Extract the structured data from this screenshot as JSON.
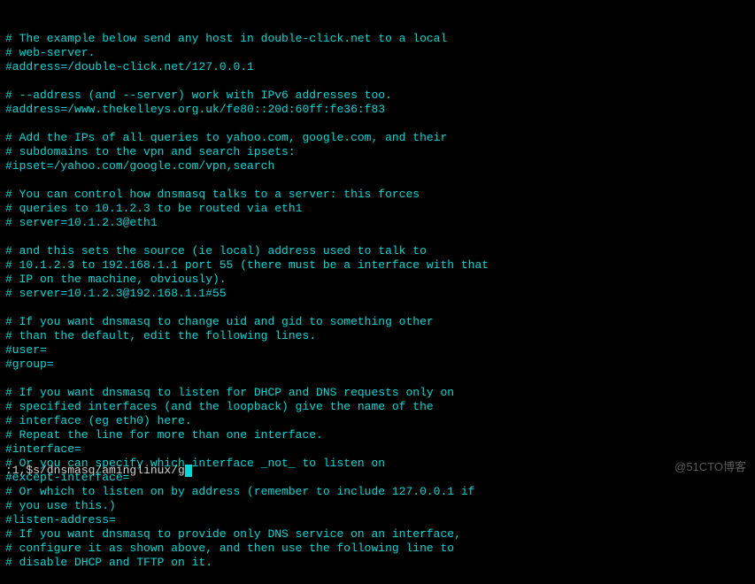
{
  "lines": [
    "# The example below send any host in double-click.net to a local",
    "# web-server.",
    "#address=/double-click.net/127.0.0.1",
    "",
    "# --address (and --server) work with IPv6 addresses too.",
    "#address=/www.thekelleys.org.uk/fe80::20d:60ff:fe36:f83",
    "",
    "# Add the IPs of all queries to yahoo.com, google.com, and their",
    "# subdomains to the vpn and search ipsets:",
    "#ipset=/yahoo.com/google.com/vpn,search",
    "",
    "# You can control how dnsmasq talks to a server: this forces",
    "# queries to 10.1.2.3 to be routed via eth1",
    "# server=10.1.2.3@eth1",
    "",
    "# and this sets the source (ie local) address used to talk to",
    "# 10.1.2.3 to 192.168.1.1 port 55 (there must be a interface with that",
    "# IP on the machine, obviously).",
    "# server=10.1.2.3@192.168.1.1#55",
    "",
    "# If you want dnsmasq to change uid and gid to something other",
    "# than the default, edit the following lines.",
    "#user=",
    "#group=",
    "",
    "# If you want dnsmasq to listen for DHCP and DNS requests only on",
    "# specified interfaces (and the loopback) give the name of the",
    "# interface (eg eth0) here.",
    "# Repeat the line for more than one interface.",
    "#interface=",
    "# Or you can specify which interface _not_ to listen on",
    "#except-interface=",
    "# Or which to listen on by address (remember to include 127.0.0.1 if",
    "# you use this.)",
    "#listen-address=",
    "# If you want dnsmasq to provide only DNS service on an interface,",
    "# configure it as shown above, and then use the following line to",
    "# disable DHCP and TFTP on it."
  ],
  "status": ":1,$s/dnsmasq/aminglinux/g",
  "watermark": "@51CTO博客"
}
